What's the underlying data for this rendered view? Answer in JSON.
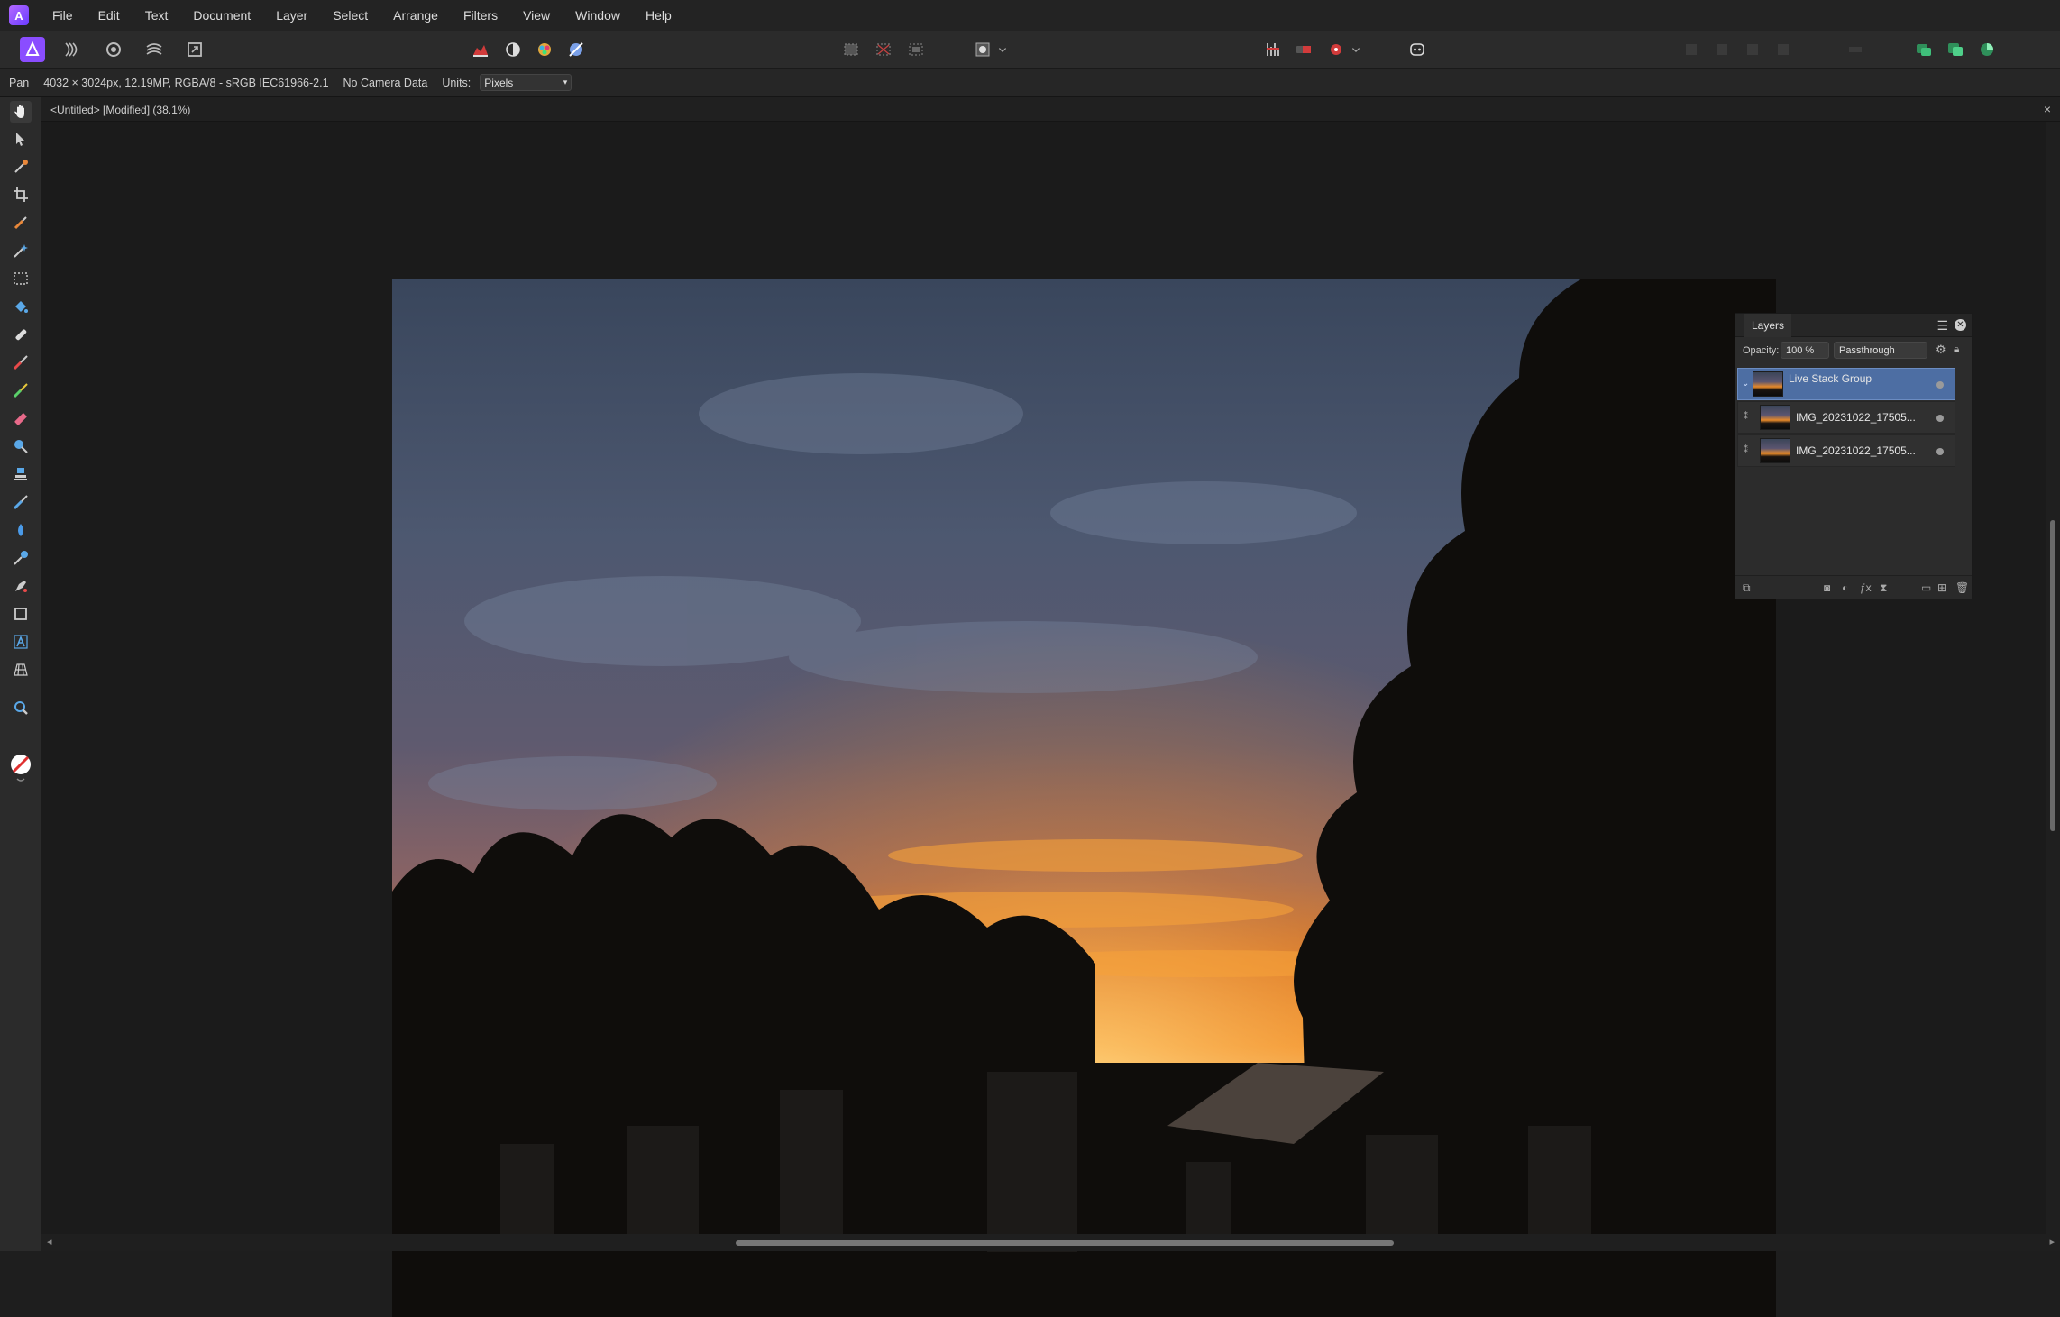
{
  "app": {
    "name": "Affinity Photo"
  },
  "menu": [
    "File",
    "Edit",
    "Text",
    "Document",
    "Layer",
    "Select",
    "Arrange",
    "Filters",
    "View",
    "Window",
    "Help"
  ],
  "toolbar": {
    "personas": [
      "photo-persona-icon",
      "liquify-persona-icon",
      "develop-persona-icon",
      "tone-mapping-persona-icon",
      "export-persona-icon"
    ],
    "center_group_1": [
      "auto-levels-icon",
      "auto-contrast-icon",
      "auto-colour-icon",
      "auto-white-balance-icon"
    ],
    "center_group_2": [
      "selection-full-icon",
      "selection-clear-icon",
      "selection-invert-icon"
    ],
    "center_group_3": [
      "quick-mask-icon"
    ],
    "right_group_1": [
      "snapping-icon",
      "record-icon",
      "assistant-icon"
    ],
    "assistant": [
      "assistant-face-icon"
    ],
    "right_studio": [
      "share-icon",
      "studio-link-icon",
      "studio-toggle-icon"
    ]
  },
  "context": {
    "tool_name": "Pan",
    "doc_info": "4032 × 3024px, 12.19MP, RGBA/8 - sRGB IEC61966-2.1",
    "camera": "No Camera Data",
    "units_label": "Units:",
    "units_value": "Pixels"
  },
  "document": {
    "tab_title": "<Untitled> [Modified] (38.1%)",
    "close": "×"
  },
  "tools": [
    "hand-icon",
    "move-icon",
    "colour-picker-icon",
    "crop-icon",
    "paint-brush-icon",
    "flood-select-icon",
    "marquee-icon",
    "flood-fill-icon",
    "healing-icon",
    "brush-icon",
    "pixel-icon",
    "erase-icon",
    "dodge-icon",
    "clone-icon",
    "smudge-icon",
    "blur-icon",
    "sponge-icon",
    "pen-icon",
    "rectangle-icon",
    "text-icon",
    "mesh-warp-icon",
    "zoom-icon",
    "colour-swatch-icon"
  ],
  "layers_panel": {
    "tab": "Layers",
    "opacity_label": "Opacity:",
    "opacity_value": "100 %",
    "blend_mode": "Passthrough",
    "layers": [
      {
        "name": "Live Stack Group",
        "selected": true,
        "type": "group"
      },
      {
        "name": "IMG_20231022_17505...",
        "selected": false,
        "type": "pixel"
      },
      {
        "name": "IMG_20231022_17505...",
        "selected": false,
        "type": "pixel"
      }
    ]
  },
  "colors": {
    "accent": "#4d6ea3",
    "chrome": "#2b2b2b",
    "workspace": "#1b1b1b"
  }
}
